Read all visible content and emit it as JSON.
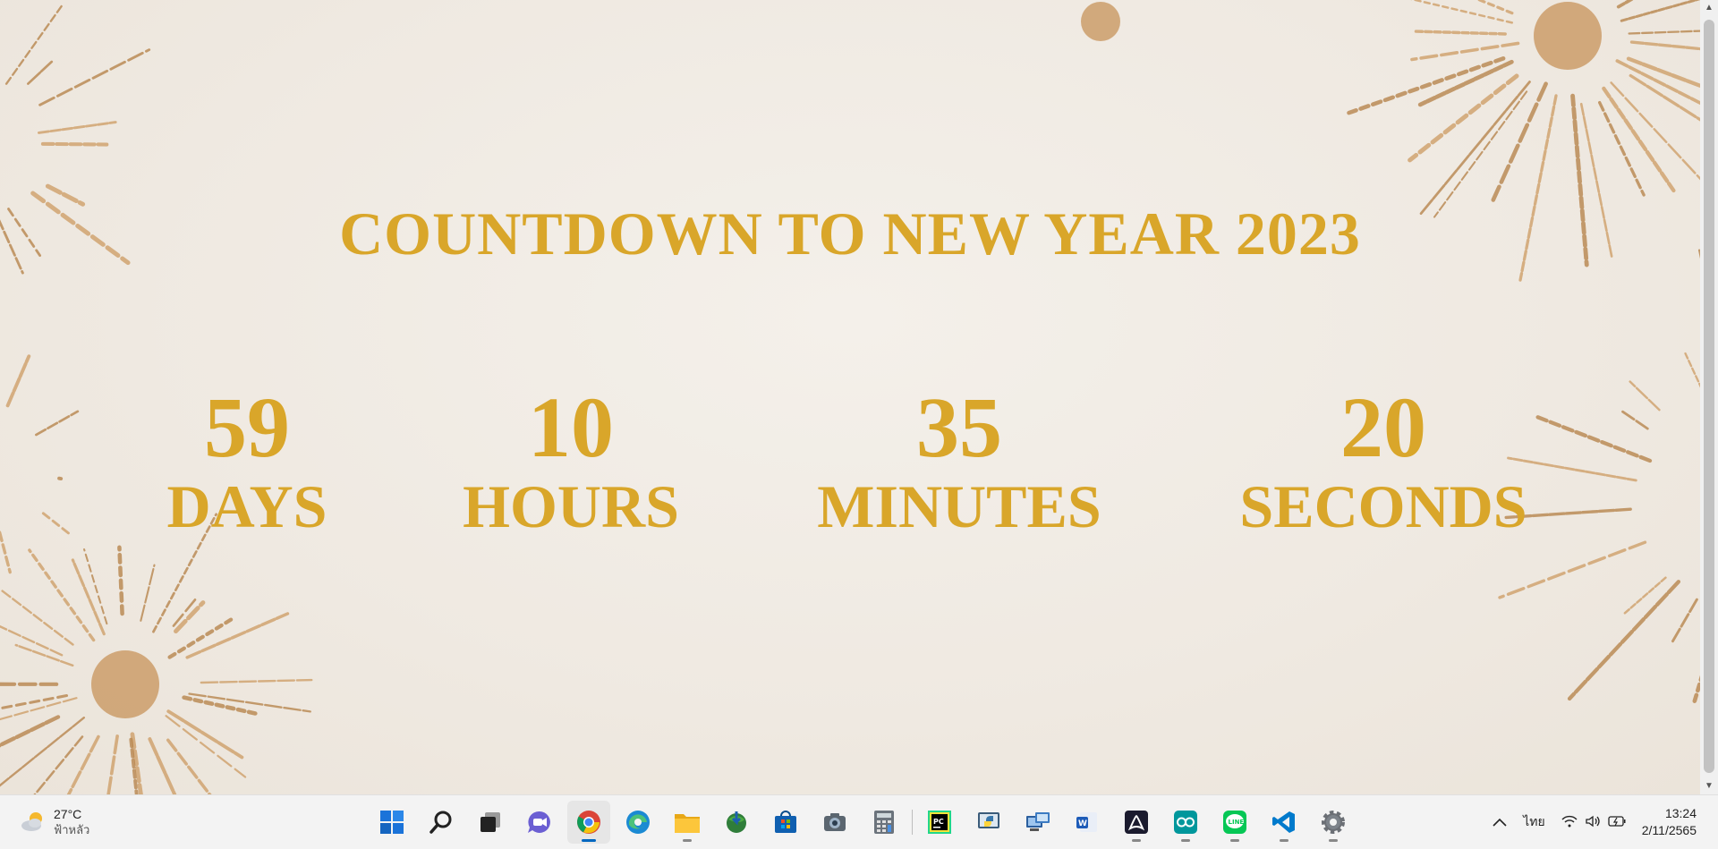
{
  "page": {
    "title": "COUNTDOWN TO NEW YEAR 2023",
    "countdown": [
      {
        "value": "59",
        "label": "DAYS"
      },
      {
        "value": "10",
        "label": "HOURS"
      },
      {
        "value": "35",
        "label": "MINUTES"
      },
      {
        "value": "20",
        "label": "SECONDS"
      }
    ]
  },
  "taskbar": {
    "weather": {
      "temp": "27°C",
      "condition": "ฟ้าหลัว",
      "icon": "partly-cloudy-icon"
    },
    "apps": [
      {
        "name": "start-button",
        "icon": "windows-logo-icon",
        "open": false
      },
      {
        "name": "search-button",
        "icon": "search-icon",
        "open": false
      },
      {
        "name": "task-view-button",
        "icon": "task-view-icon",
        "open": false
      },
      {
        "name": "teams-chat-button",
        "icon": "chat-icon",
        "open": false
      },
      {
        "name": "chrome-button",
        "icon": "chrome-icon",
        "open": true,
        "active": true
      },
      {
        "name": "edge-button",
        "icon": "edge-icon",
        "open": false
      },
      {
        "name": "file-explorer-button",
        "icon": "folder-icon",
        "open": true
      },
      {
        "name": "internet-download-manager-button",
        "icon": "idm-globe-icon",
        "open": false
      },
      {
        "name": "microsoft-store-button",
        "icon": "store-icon",
        "open": false
      },
      {
        "name": "camera-button",
        "icon": "camera-icon",
        "open": false
      },
      {
        "name": "calculator-button",
        "icon": "calculator-icon",
        "open": false
      },
      {
        "name": "pycharm-button",
        "icon": "pycharm-icon",
        "open": false
      },
      {
        "name": "python-idle-button",
        "icon": "python-icon",
        "open": false
      },
      {
        "name": "remote-desktop-button",
        "icon": "remote-desktop-icon",
        "open": false
      },
      {
        "name": "word-app-button",
        "icon": "word-icon",
        "open": false
      },
      {
        "name": "acrobat-button",
        "icon": "acrobat-icon",
        "open": true
      },
      {
        "name": "arduino-button",
        "icon": "arduino-icon",
        "open": true
      },
      {
        "name": "line-button",
        "icon": "line-icon",
        "open": true
      },
      {
        "name": "vscode-button",
        "icon": "vscode-icon",
        "open": true
      },
      {
        "name": "settings-button",
        "icon": "gear-icon",
        "open": true
      }
    ],
    "tray": {
      "language": "ไทย",
      "time": "13:24",
      "date": "2/11/2565"
    }
  },
  "colors": {
    "accent_gold": "#d9a62a",
    "taskbar_accent": "#0067c0"
  }
}
